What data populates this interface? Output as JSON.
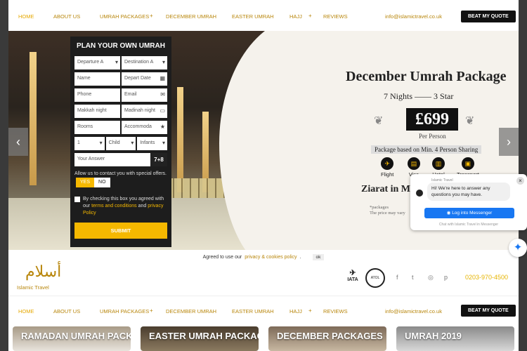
{
  "nav": {
    "items": [
      {
        "label": "HOME",
        "active": true
      },
      {
        "label": "ABOUT US"
      },
      {
        "label": "UMRAH PACKAGES",
        "plus": "+"
      },
      {
        "label": "DECEMBER UMRAH"
      },
      {
        "label": "EASTER UMRAH"
      },
      {
        "label": "HAJJ",
        "plus": "+"
      },
      {
        "label": "REVIEWS"
      }
    ],
    "email": "info@islamictravel.co.uk",
    "quote_button": "BEAT MY QUOTE"
  },
  "form": {
    "title": "PLAN YOUR OWN UMRAH",
    "departure": "Departure A",
    "destination": "Destination A",
    "name": "Name",
    "depart_date": "Depart Date",
    "phone": "Phone",
    "email": "Email",
    "makkah_nights": "Makkah night",
    "madinah_nights": "Madinah night",
    "rooms": "Rooms",
    "accommodation": "Accommoda",
    "adults": "1",
    "child": "Child",
    "infants": "Infants",
    "captcha_placeholder": "Your Answer",
    "captcha": "7+8",
    "contact_text": "Allow us to contact you with special offers.",
    "yes": "YES",
    "no": "NO",
    "terms_prefix": "By checking this box you agreed with our",
    "terms_link": "terms and conditions",
    "terms_and": "and",
    "privacy_link": "privacy Policy",
    "submit": "SUBMIT"
  },
  "package": {
    "title": "December Umrah Package",
    "nights": "7 Nights",
    "stars": "3 Star",
    "price": "£699",
    "per": "Per Person",
    "based": "Package based on Min. 4 Person Sharing",
    "features": [
      "Flight",
      "Visa",
      "Hotel",
      "Transport"
    ],
    "ziarat": "Ziarat in Ma",
    "note1": "*packages",
    "note2": "The price may vary"
  },
  "chat": {
    "page_name": "Islamic Travel",
    "message": "Hi! We're here to answer any questions you may have.",
    "button": "Log into Messenger",
    "footer": "Chat with Islamic Travel in Messenger"
  },
  "cookie": {
    "text": "Agreed to use our",
    "link": "privacy & cookies policy",
    "period": ".",
    "ok": "ok"
  },
  "brand": {
    "logo_text": "Islamic Travel",
    "iata": "IATA",
    "atol": "ATOL",
    "phone": "0203-970-4500"
  },
  "thumbs": [
    "RAMADAN UMRAH PACKAGES",
    "EASTER UMRAH PACKAGES",
    "DECEMBER PACKAGES",
    "UMRAH 2019"
  ],
  "colors": {
    "gold": "#b8860b",
    "yellow": "#f5b800",
    "dark": "#1d1d1d",
    "messenger": "#1877f2"
  }
}
